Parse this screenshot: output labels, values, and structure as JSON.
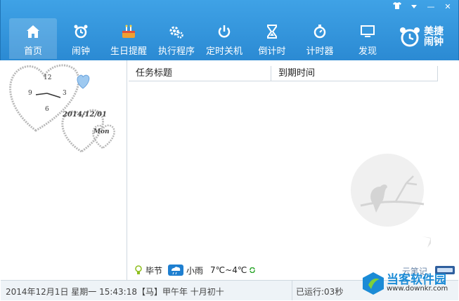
{
  "window_controls": {
    "skin_icon": "shirt-icon",
    "menu_icon": "menu-arrow-icon",
    "minimize": "—",
    "close": "✕"
  },
  "nav": {
    "items": [
      {
        "label": "首页",
        "icon": "home-icon",
        "active": true
      },
      {
        "label": "闹钟",
        "icon": "alarm-clock-icon"
      },
      {
        "label": "生日提醒",
        "icon": "birthday-cake-icon"
      },
      {
        "label": "执行程序",
        "icon": "gears-icon"
      },
      {
        "label": "定时关机",
        "icon": "power-icon"
      },
      {
        "label": "倒计时",
        "icon": "hourglass-icon"
      },
      {
        "label": "计时器",
        "icon": "stopwatch-icon"
      },
      {
        "label": "发现",
        "icon": "monitor-icon"
      }
    ]
  },
  "logo": {
    "line1": "美捷",
    "line2": "闹钟"
  },
  "clock_widget": {
    "num12": "12",
    "num3": "3",
    "num6": "6",
    "num9": "9",
    "date": "2014/12/01",
    "weekday": "Mon"
  },
  "table": {
    "columns": [
      "任务标题",
      "到期时间"
    ]
  },
  "weather": {
    "city": "毕节",
    "condition": "小雨",
    "temp": "7℃~4℃"
  },
  "cloud_note": "云笔记",
  "status": {
    "datetime": "2014年12月1日 星期一 15:43:18【马】甲午年 十月初十",
    "running": "已运行:03秒"
  },
  "watermark": {
    "brand": "当客软件园",
    "url": "www.downkr.com"
  },
  "colors": {
    "accent": "#2b8ad3",
    "header_top": "#3fa2e6"
  }
}
